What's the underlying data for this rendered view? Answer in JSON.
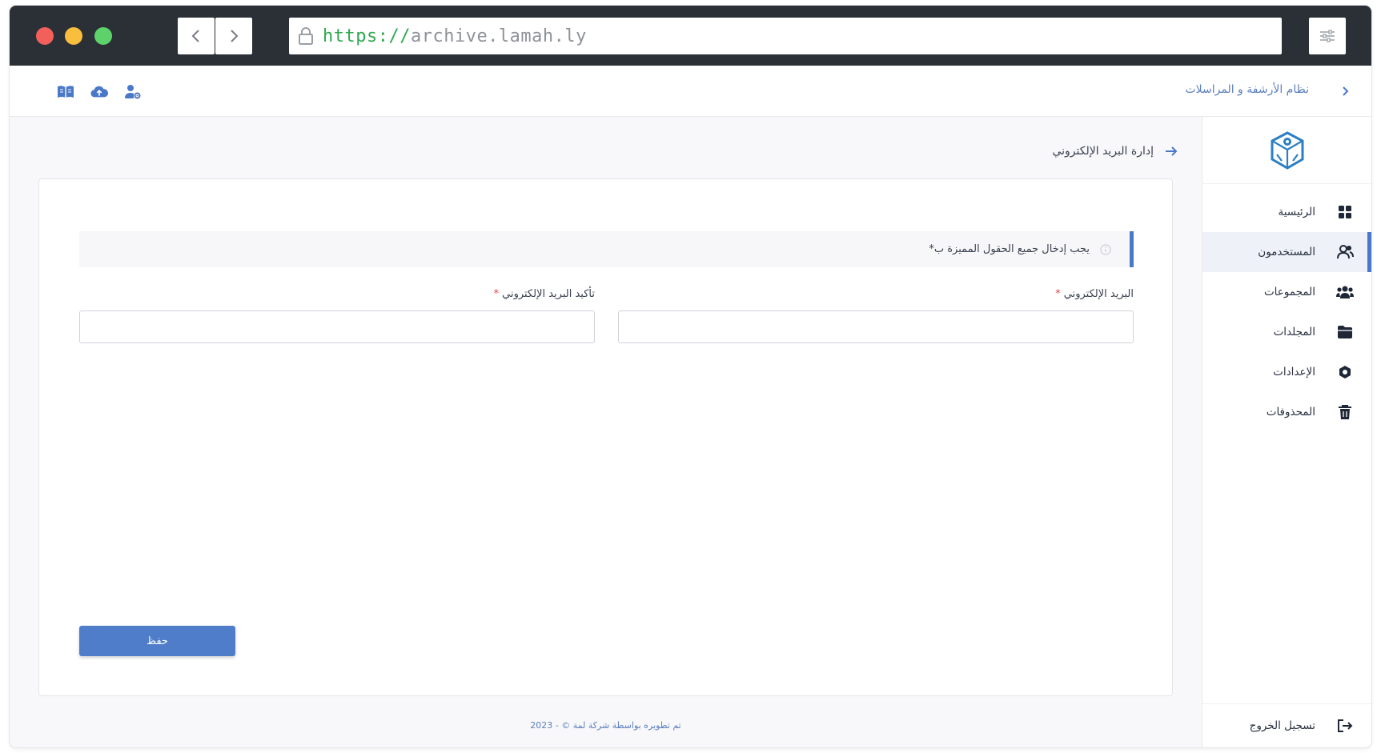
{
  "browser": {
    "url_scheme": "https://",
    "url_host": "archive.lamah.ly"
  },
  "topbar": {
    "app_title": "نظام الأرشفة و المراسلات",
    "icons": [
      "book-icon",
      "cloud-upload-icon",
      "user-settings-icon"
    ]
  },
  "sidebar": {
    "items": [
      {
        "label": "الرئيسية",
        "icon": "dashboard-icon",
        "active": false
      },
      {
        "label": "المستخدمون",
        "icon": "users-icon",
        "active": true
      },
      {
        "label": "المجموعات",
        "icon": "groups-icon",
        "active": false
      },
      {
        "label": "المجلدات",
        "icon": "folder-icon",
        "active": false
      },
      {
        "label": "الإعدادات",
        "icon": "settings-icon",
        "active": false
      },
      {
        "label": "المحذوفات",
        "icon": "trash-icon",
        "active": false
      }
    ],
    "logout_label": "تسجيل الخروج"
  },
  "page": {
    "title": "إدارة البريد الإلكتروني",
    "notice": "يجب إدخال جميع الحقول المميزة ب*",
    "fields": {
      "email_label": "البريد الإلكتروني",
      "confirm_label": "تأكيد البريد الإلكتروني",
      "required_mark": "*",
      "email_value": "",
      "confirm_value": ""
    },
    "save_label": "حفظ"
  },
  "footer": {
    "text": "تم تطويره بواسطة شركة لمة © - 2023"
  },
  "colors": {
    "accent": "#4a78c8",
    "chrome": "#2b2f36",
    "link": "#5b7fbf",
    "required": "#e04848"
  }
}
